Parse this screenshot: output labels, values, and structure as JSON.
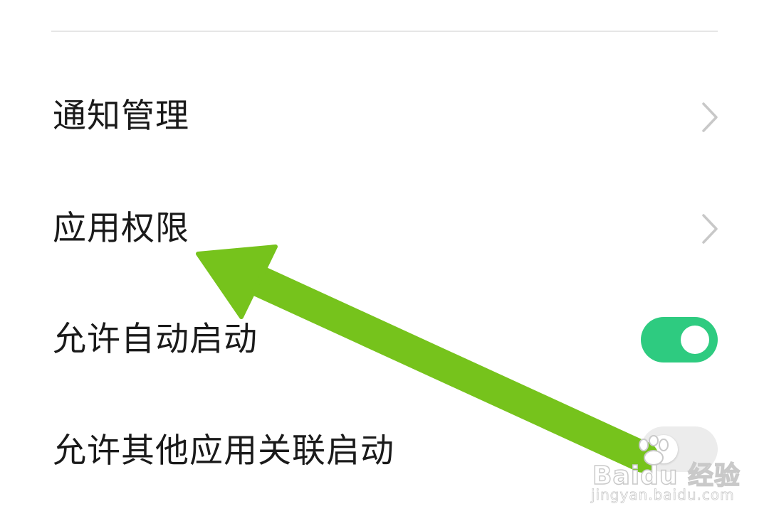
{
  "settings": {
    "items": [
      {
        "label": "通知管理",
        "control": "chevron"
      },
      {
        "label": "应用权限",
        "control": "chevron"
      },
      {
        "label": "允许自动启动",
        "control": "toggle",
        "enabled": true
      },
      {
        "label": "允许其他应用关联启动",
        "control": "toggle",
        "enabled": false
      }
    ]
  },
  "colors": {
    "toggle_on": "#2ecb80",
    "toggle_off": "#ececec",
    "annotation_arrow": "#76c31c",
    "chevron": "#c8c8c8"
  },
  "watermark": {
    "brand": "Baidu 经验",
    "url": "jingyan.baidu.com"
  }
}
